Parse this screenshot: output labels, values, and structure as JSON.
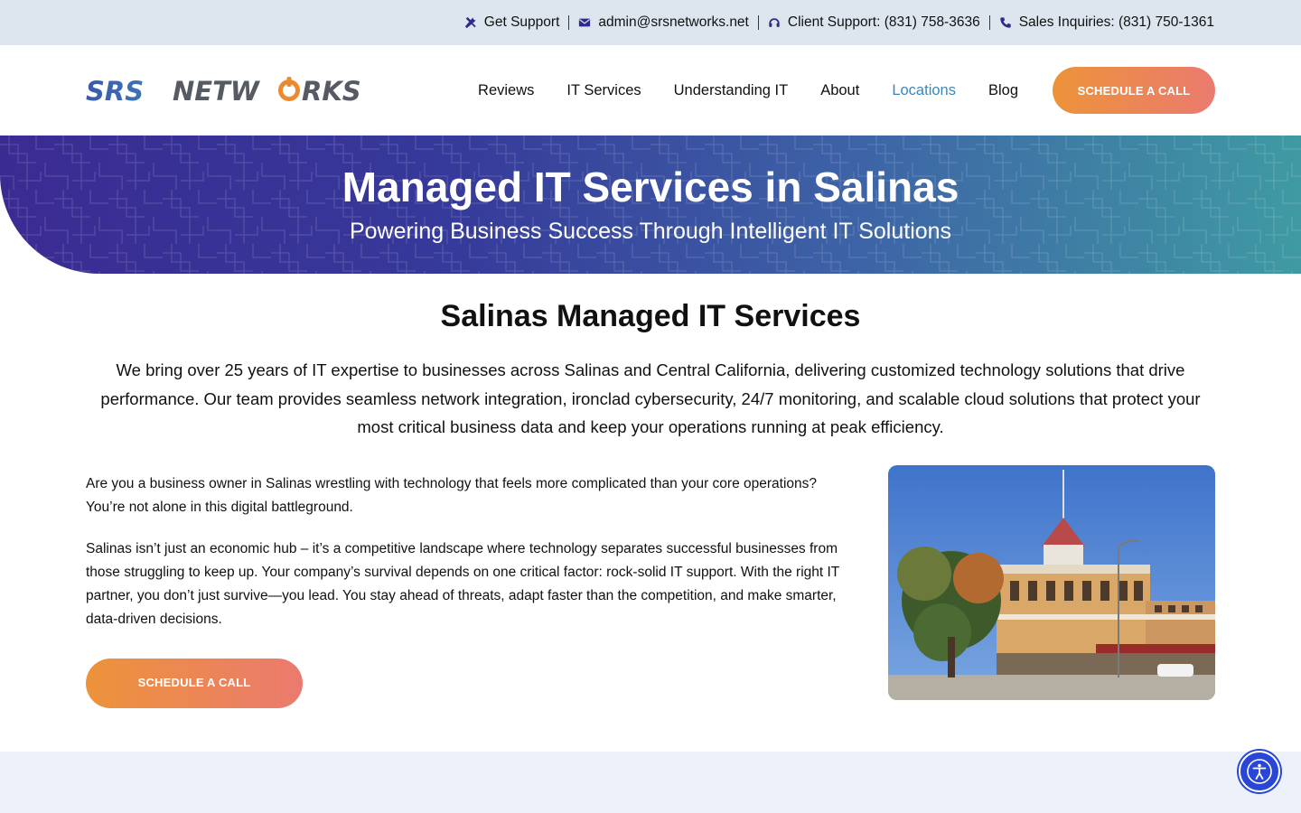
{
  "topbar": {
    "get_support": "Get Support",
    "email": "admin@srsnetworks.net",
    "client_support": "Client Support: (831) 758-3636",
    "sales": "Sales Inquiries: (831) 750-1361"
  },
  "logo": {
    "part1": "SRS",
    "part2a": "NETW",
    "part2b": "RKS"
  },
  "nav": {
    "items": [
      "Reviews",
      "IT Services",
      "Understanding IT",
      "About",
      "Locations",
      "Blog"
    ],
    "active": "Locations",
    "cta": "SCHEDULE A CALL"
  },
  "hero": {
    "title": "Managed IT Services in Salinas",
    "subtitle": "Powering Business Success Through Intelligent IT Solutions"
  },
  "main": {
    "heading": "Salinas Managed IT Services",
    "intro": "We bring over 25 years of IT expertise to businesses across Salinas and Central California, delivering customized technology solutions that drive performance. Our team provides seamless network integration, ironclad cybersecurity, 24/7 monitoring, and scalable cloud solutions that protect your most critical business data and keep your operations running at peak efficiency.",
    "para1": "Are you a business owner in Salinas wrestling with technology that feels more complicated than your core operations? You’re not alone in this digital battleground.",
    "para2": "Salinas isn’t just an economic hub – it’s a competitive landscape where technology separates successful businesses from those struggling to keep up. Your company’s survival depends on one critical factor: rock-solid IT support. With the right IT partner, you don’t just survive—you lead. You stay ahead of threats, adapt faster than the competition, and make smarter, data-driven decisions.",
    "cta": "SCHEDULE A CALL"
  },
  "colors": {
    "brand_blue": "#3a5aa8",
    "brand_orange": "#ec8a2e",
    "nav_active": "#3a87b8"
  },
  "icons": [
    "tools-icon",
    "envelope-icon",
    "headset-icon",
    "phone-icon",
    "accessibility-icon"
  ]
}
